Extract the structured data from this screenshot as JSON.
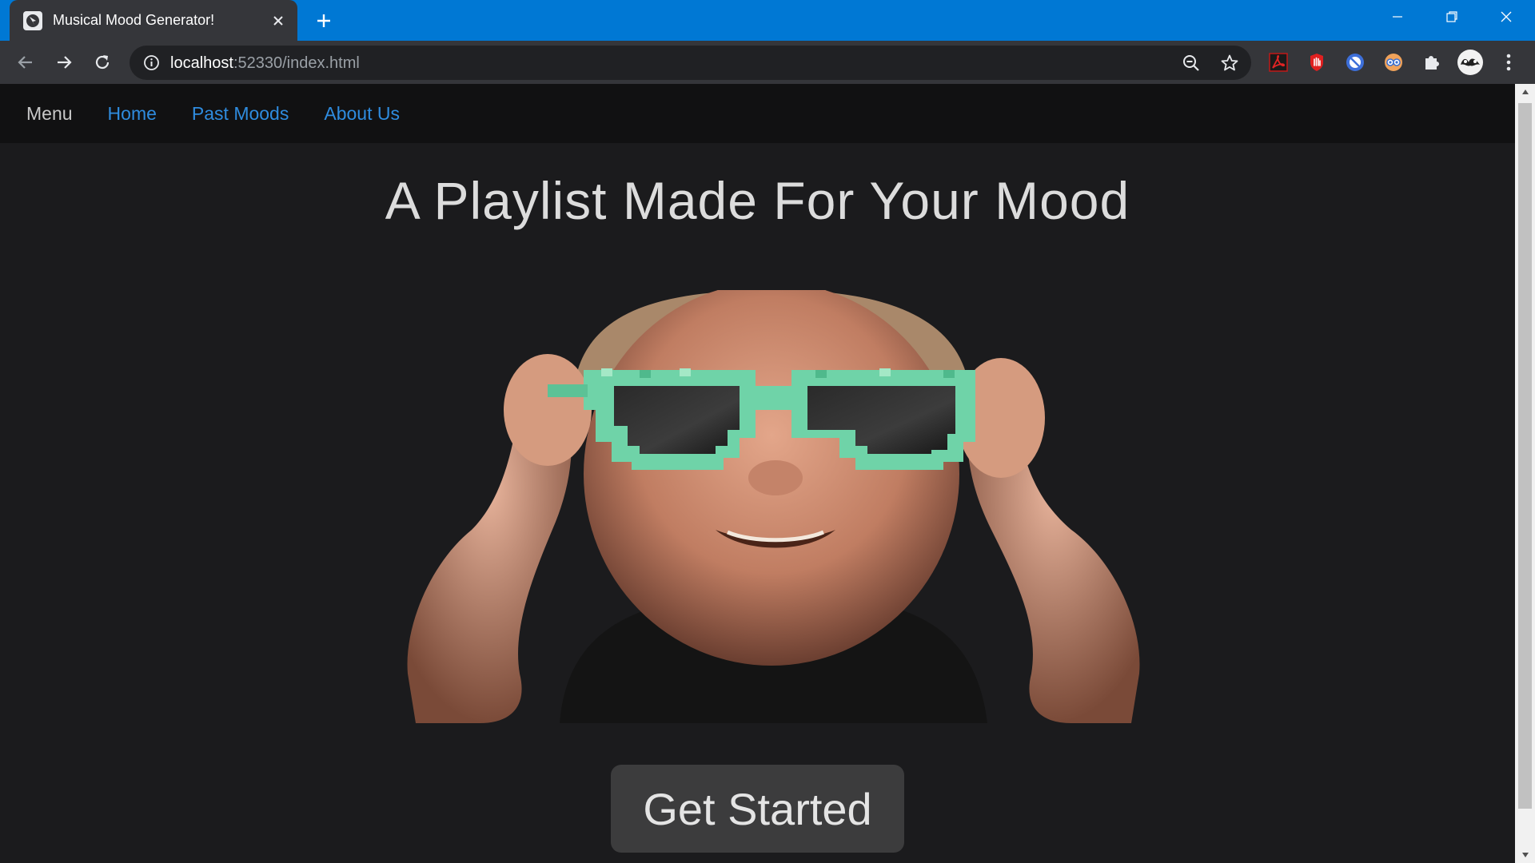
{
  "browser": {
    "tab_title": "Musical Mood Generator!",
    "url_host": "localhost",
    "url_rest": ":52330/index.html"
  },
  "navbar": {
    "brand": "Menu",
    "links": [
      {
        "label": "Home"
      },
      {
        "label": "Past Moods"
      },
      {
        "label": "About Us"
      }
    ],
    "link_color": "#2f8cdf"
  },
  "hero": {
    "title": "A Playlist Made For Your Mood",
    "cta_label": "Get Started"
  },
  "colors": {
    "titlebar": "#0078d4",
    "page_bg": "#1b1b1d",
    "navbar_bg": "#111112",
    "glasses": "#6fd3a8"
  },
  "icons": [
    "favicon-icon",
    "close-icon",
    "plus-icon",
    "minimize-icon",
    "restore-icon",
    "back-icon",
    "forward-icon",
    "reload-icon",
    "info-icon",
    "zoom-out-icon",
    "star-icon",
    "pdf-icon",
    "hand-stop-icon",
    "block-icon",
    "eyes-extension-icon",
    "puzzle-icon",
    "profile-avatar-icon",
    "more-vert-icon"
  ]
}
